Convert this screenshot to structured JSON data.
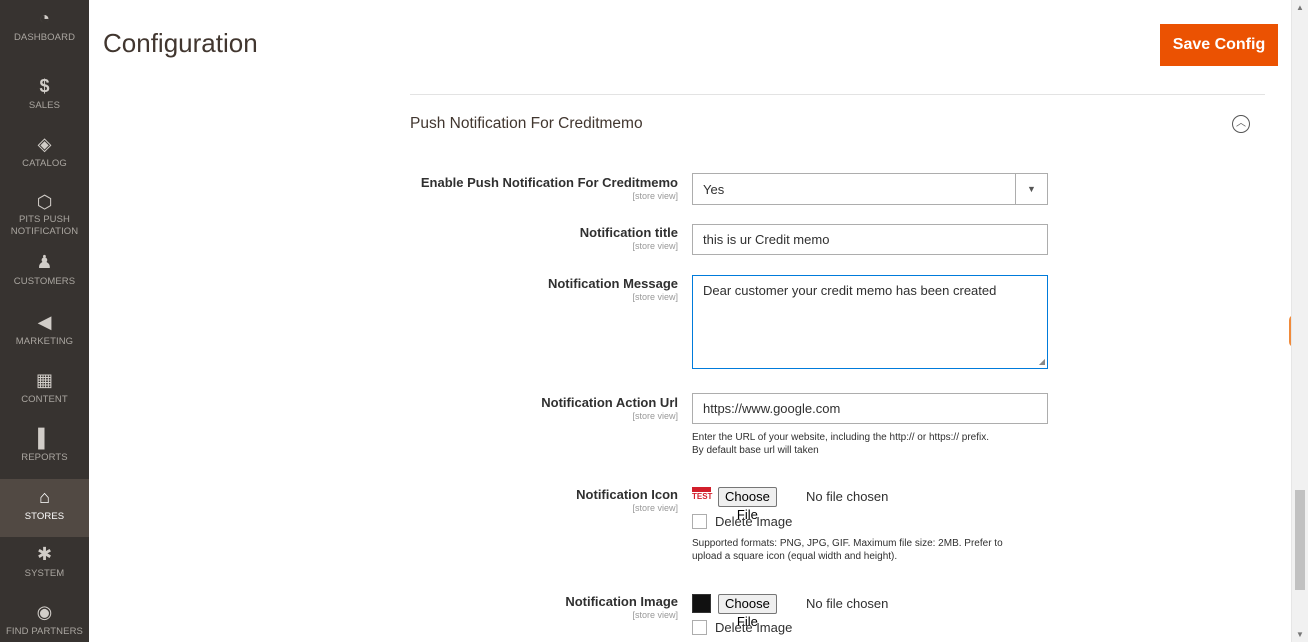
{
  "sidebar": {
    "items": [
      {
        "label": "DASHBOARD",
        "icon": "dashboard-icon",
        "glyph": "◔"
      },
      {
        "label": "SALES",
        "icon": "dollar-icon",
        "glyph": "$"
      },
      {
        "label": "CATALOG",
        "icon": "box-icon",
        "glyph": "◈"
      },
      {
        "label": "PITS PUSH",
        "label2": "NOTIFICATION",
        "icon": "hexagon-icon",
        "glyph": "⬡"
      },
      {
        "label": "CUSTOMERS",
        "icon": "person-icon",
        "glyph": "♟"
      },
      {
        "label": "MARKETING",
        "icon": "megaphone-icon",
        "glyph": "◀"
      },
      {
        "label": "CONTENT",
        "icon": "layout-icon",
        "glyph": "▦"
      },
      {
        "label": "REPORTS",
        "icon": "bar-chart-icon",
        "glyph": "▌"
      },
      {
        "label": "STORES",
        "icon": "store-icon",
        "glyph": "⌂"
      },
      {
        "label": "SYSTEM",
        "icon": "gear-icon",
        "glyph": "✱"
      },
      {
        "label": "FIND PARTNERS",
        "icon": "partners-icon",
        "glyph": "◉"
      }
    ],
    "active": "STORES"
  },
  "header": {
    "title": "Configuration",
    "save_label": "Save Config"
  },
  "section": {
    "title": "Push Notification For Creditmemo",
    "collapse_icon": "chevron-up-circle-icon"
  },
  "fields": {
    "enable": {
      "label": "Enable Push Notification For Creditmemo",
      "scope": "[store view]",
      "value": "Yes"
    },
    "title": {
      "label": "Notification title",
      "scope": "[store view]",
      "value": "this is ur Credit memo"
    },
    "message": {
      "label": "Notification Message",
      "scope": "[store view]",
      "value": "Dear customer your credit memo has been created"
    },
    "action_url": {
      "label": "Notification Action Url",
      "scope": "[store view]",
      "value": "https://www.google.com",
      "note1": "Enter the URL of your website, including the http:// or https:// prefix.",
      "note2": "By default base url will taken"
    },
    "icon": {
      "label": "Notification Icon",
      "scope": "[store view]",
      "thumb_text": "TEST",
      "choose_label": "Choose File",
      "file_status": "No file chosen",
      "delete_label": "Delete Image",
      "note1": "Supported formats: PNG, JPG, GIF. Maximum file size: 2MB. Prefer to",
      "note2": "upload a square icon (equal width and height)."
    },
    "image": {
      "label": "Notification Image",
      "scope": "[store view]",
      "choose_label": "Choose File",
      "file_status": "No file chosen",
      "delete_label": "Delete Image"
    }
  },
  "colors": {
    "sidebar_bg": "#373330",
    "accent": "#eb5202",
    "focus_border": "#007bdb"
  }
}
